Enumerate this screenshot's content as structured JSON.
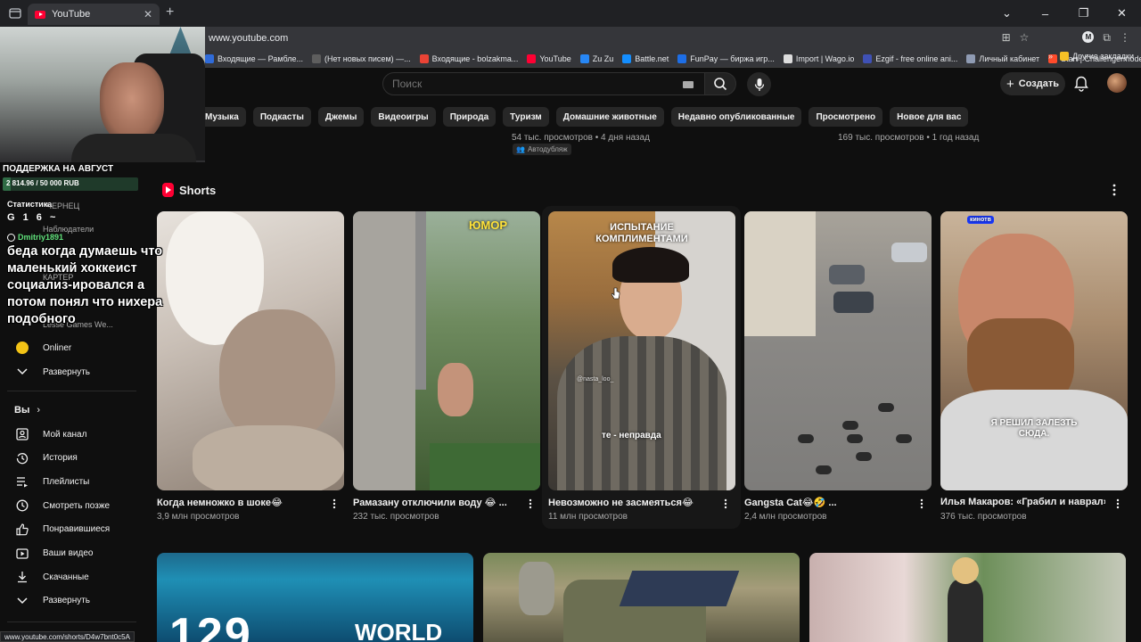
{
  "browser": {
    "tab_title": "YouTube",
    "url": "www.youtube.com",
    "bookmarks": [
      {
        "label": "Входящие — Рамбле...",
        "color": "#2f6bd9"
      },
      {
        "label": "(Нет новых писем) —...",
        "color": "#5e5e5e"
      },
      {
        "label": "Входящие - bolzakma...",
        "color": "#ea4335"
      },
      {
        "label": "YouTube",
        "color": "#ff0033"
      },
      {
        "label": "Zu Zu",
        "color": "#2787f5"
      },
      {
        "label": "Battle.net",
        "color": "#148eff"
      },
      {
        "label": "FunPay — биржа игр...",
        "color": "#1d6ee6"
      },
      {
        "label": "Import | Wago.io",
        "color": "#dddddd"
      },
      {
        "label": "Ezgif - free online ani...",
        "color": "#3f51b5"
      },
      {
        "label": "Личный кабинет",
        "color": "#8f9bb3"
      },
      {
        "label": "Start | Challengermode",
        "color": "#ff4b2b"
      }
    ],
    "other_bookmarks": "Другие закладки",
    "status_url": "www.youtube.com/shorts/D4w7bnt0c5A"
  },
  "header": {
    "search_placeholder": "Поиск",
    "create_label": "Создать"
  },
  "chips": [
    "Музыка",
    "Подкасты",
    "Джемы",
    "Видеоигры",
    "Природа",
    "Туризм",
    "Домашние животные",
    "Недавно опубликованные",
    "Просмотрено",
    "Новое для вас"
  ],
  "prev_row": {
    "meta1": "54 тыс. просмотров • 4 дня назад",
    "dub_badge": "Автодубляж",
    "meta2": "169 тыс. просмотров • 1 год назад"
  },
  "shorts": {
    "title": "Shorts",
    "items": [
      {
        "title": "Когда немножко в шоке😂",
        "views": "3,9 млн просмотров"
      },
      {
        "title": "Рамазану отключили воду 😂 ...",
        "views": "232 тыс. просмотров",
        "overlay": "ЮМОР"
      },
      {
        "title": "Невозможно не засмеяться😂",
        "views": "11 млн просмотров",
        "overlay": "ИСПЫТАНИЕ КОМПЛИМЕНТАМИ",
        "caption": "те - неправда",
        "watermark": "@nasta_loo_"
      },
      {
        "title": "Gangsta Cat😂🤣 ...",
        "views": "2,4 млн просмотров"
      },
      {
        "title": "Илья Макаров: «Грабил и наврал»",
        "views": "376 тыс. просмотров",
        "overlay": "Я РЕШИЛ ЗАЛЕЗТЬ СЮДА.",
        "badge": "кинотв"
      }
    ]
  },
  "videos": [
    {
      "text1": "129",
      "text2": "WORLD"
    },
    {},
    {}
  ],
  "sidebar": {
    "expand_subs": "Развернуть",
    "you_label": "Вы",
    "items": [
      {
        "label": "Мой канал",
        "icon": "channel-icon"
      },
      {
        "label": "История",
        "icon": "history-icon"
      },
      {
        "label": "Плейлисты",
        "icon": "playlists-icon"
      },
      {
        "label": "Смотреть позже",
        "icon": "watch-later-icon"
      },
      {
        "label": "Понравившиеся",
        "icon": "like-icon"
      },
      {
        "label": "Ваши видео",
        "icon": "your-videos-icon"
      },
      {
        "label": "Скачанные",
        "icon": "download-icon"
      },
      {
        "label": "Развернуть",
        "icon": "chevron-down-icon"
      }
    ],
    "subs_visible": [
      "ЧЕРНЕЦ",
      "Наблюдатели",
      "КАРТЕР",
      "Lesse Games We...",
      "Onliner"
    ]
  },
  "overlay": {
    "support_title": "ПОДДЕРЖКА НА АВГУСТ",
    "progress_text": "2 814.96 / 50 000 RUB",
    "progress_fraction": 0.056,
    "stats_label": "Статистика",
    "stats_row": "G 1 6 ~",
    "chat_user": "Dmitriy1891",
    "chat_message": "беда когда думаешь что маленький хоккеист социализ-ировался а потом понял что нихера подобного"
  }
}
